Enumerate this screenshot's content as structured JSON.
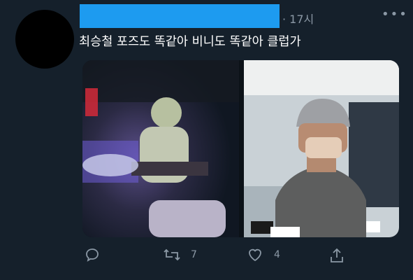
{
  "tweet": {
    "timestamp": "· 17시",
    "more_icon": "more-horizontal-icon",
    "text": "최승철 포즈도 똑같아 비니도 똑같아 클럽가"
  },
  "actions": {
    "reply_icon": "reply-icon",
    "retweet_icon": "retweet-icon",
    "retweet_count": "7",
    "like_icon": "heart-icon",
    "like_count": "4",
    "share_icon": "share-icon"
  },
  "colors": {
    "background": "#15202b",
    "muted": "#8b98a5",
    "redaction": "#1d9bf0"
  }
}
